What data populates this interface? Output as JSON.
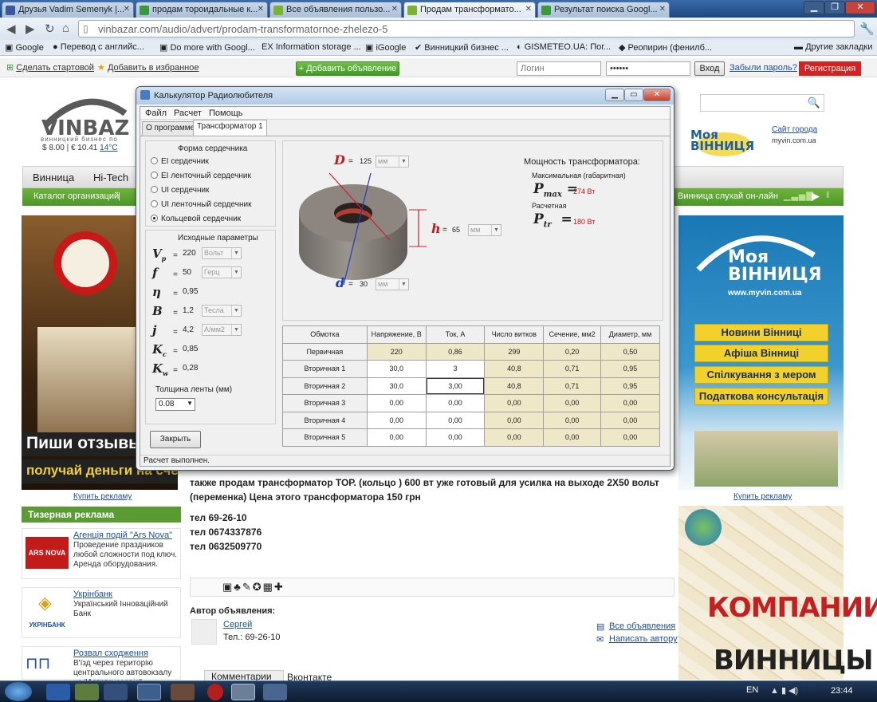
{
  "browser": {
    "tabs": [
      {
        "title": "Друзья Vadim Semenyk |...",
        "color": "#3b5998"
      },
      {
        "title": "продам тороидальные к...",
        "color": "#3a9a3a"
      },
      {
        "title": "Все объявления пользо...",
        "color": "#7ab32f"
      },
      {
        "title": "Продам трансформато...",
        "color": "#7ab32f"
      },
      {
        "title": "Результат поиска Googl...",
        "color": "#3a9a3a"
      }
    ],
    "url": "vinbazar.com/audio/advert/prodam-transformatornoe-zhelezo-5",
    "bookmarks": [
      "Google",
      "Перевод с английс...",
      "Do more with Googl...",
      "Information storage ...",
      "iGoogle",
      "Винницкий бизнес ...",
      "GISMETEO.UA: Пог...",
      "Реопирин (фенилб...",
      "Другие закладки"
    ]
  },
  "site": {
    "make_home": "Сделать стартовой",
    "add_favorites": "Добавить в избранное",
    "add_ad": "+ Добавить объявление",
    "login_placeholder": "Логин",
    "password_mask": "••••••",
    "login_button": "Вход",
    "forgot": "Забыли пароль?",
    "register": "Регистрация",
    "logo": "VINBAZ",
    "logo_sub": "винницкий бизнес по",
    "currency": [
      "$ 8.00",
      "€ 10.41",
      "14°C"
    ],
    "nav": [
      "Винница",
      "Hi-Tech"
    ],
    "subnav": [
      "Каталог организаций",
      "|"
    ],
    "radio": "Винница слухай он-лайн",
    "myvin_site": "Сайт города",
    "myvin_url": "myvin.com.ua",
    "myvin_logo": "Моя ВІННИЦЯ",
    "left_banner": [
      "Пиши отзывы -",
      "получай деньги на счет"
    ],
    "right_banner_title": "Моя ВІННИЦЯ",
    "right_banner_url": "www.myvin.com.ua",
    "right_buttons": [
      "Новини Вінниці",
      "Афіша Вінниці",
      "Спілкування з мером",
      "Податкова консультація"
    ],
    "buy_ad": "Купить рекламу",
    "teaser_header": "Тизерная реклама",
    "teasers": [
      {
        "title": "Агенція подій \"Ars Nova\"",
        "text": "Проведение праздников любой сложности под ключ. Аренда оборудования.",
        "logo": "ARS NOVA"
      },
      {
        "title": "Укрінбанк",
        "text": "Український Інноваційний Банк",
        "logo": "УКРІНБАНК"
      },
      {
        "title": "Розвал сходження",
        "text": "В'їзд через територію центрального автовокзалу на \"Автотехсервіс\"",
        "logo": ""
      }
    ],
    "ad_text": "также продам трансформатор ТОР. (кольцо ) 600 вт уже готовый для усилка на выходе 2Х50 вольт (переменка) Цена этого трансформатора 150 грн",
    "phones": [
      "тел 69-26-10",
      "тел 0674337876",
      "тел 0632509770"
    ],
    "author_label": "Автор объявления:",
    "author_name": "Сергей",
    "author_phone": "Тел.: 69-26-10",
    "all_ads": "Все объявления",
    "write_author": "Написать автору",
    "tab_comments": "Комментарии",
    "tab_vk": "Вконтакте",
    "companies": [
      "КОМПАНИИ",
      "ВИННИЦЫ"
    ]
  },
  "dialog": {
    "title": "Калькулятор Радиолюбителя",
    "menu": [
      "Файл",
      "Расчет",
      "Помощь"
    ],
    "tabs": [
      "О программе",
      "Трансформатор 1"
    ],
    "core_group": "Форма сердечника",
    "core_options": [
      {
        "label": "EI сердечник",
        "checked": false
      },
      {
        "label": "EI ленточный сердечник",
        "checked": false
      },
      {
        "label": "UI сердечник",
        "checked": false
      },
      {
        "label": "UI ленточный сердечник",
        "checked": false
      },
      {
        "label": "Кольцевой сердечник",
        "checked": true
      }
    ],
    "params_group": "Исходные параметры",
    "params": [
      {
        "sym": "V",
        "sub": "p",
        "value": "220",
        "unit": "Вольт"
      },
      {
        "sym": "f",
        "sub": "",
        "value": "50",
        "unit": "Герц"
      },
      {
        "sym": "η",
        "sub": "",
        "value": "0,95",
        "unit": ""
      },
      {
        "sym": "B",
        "sub": "",
        "value": "1,2",
        "unit": "Тесла"
      },
      {
        "sym": "j",
        "sub": "",
        "value": "4,2",
        "unit": "А/мм2"
      },
      {
        "sym": "K",
        "sub": "c",
        "value": "0,85",
        "unit": ""
      },
      {
        "sym": "K",
        "sub": "w",
        "value": "0,28",
        "unit": ""
      }
    ],
    "tape_label": "Толщина ленты (мм)",
    "tape_value": "0.08",
    "close_button": "Закрыть",
    "status": "Расчет выполнен.",
    "dims": [
      {
        "sym": "D",
        "value": "125",
        "unit": "мм"
      },
      {
        "sym": "h",
        "value": "65",
        "unit": "мм"
      },
      {
        "sym": "d",
        "value": "30",
        "unit": "мм"
      }
    ],
    "power_title": "Мощность трансформатора:",
    "pmax_label": "Максимальная (габаритная)",
    "pmax_sym": "P",
    "pmax_sub": "max",
    "pmax_value": "274 Вт",
    "ptr_label": "Расчетная",
    "ptr_sym": "P",
    "ptr_sub": "tr",
    "ptr_value": "180 Вт",
    "table_headers": [
      "Обмотка",
      "Напряжение, В",
      "Ток, А",
      "Число витков",
      "Сечение, мм2",
      "Диаметр, мм"
    ],
    "table_rows": [
      [
        "Первичная",
        "220",
        "0,86",
        "299",
        "0,20",
        "0,50"
      ],
      [
        "Вторичная 1",
        "30,0",
        "3",
        "40,8",
        "0,71",
        "0,95"
      ],
      [
        "Вторичная 2",
        "30,0",
        "3,00",
        "40,8",
        "0,71",
        "0,95"
      ],
      [
        "Вторичная 3",
        "0,00",
        "0,00",
        "0,00",
        "0,00",
        "0,00"
      ],
      [
        "Вторичная 4",
        "0,00",
        "0,00",
        "0,00",
        "0,00",
        "0,00"
      ],
      [
        "Вторичная 5",
        "0,00",
        "0,00",
        "0,00",
        "0,00",
        "0,00"
      ]
    ]
  },
  "taskbar": {
    "lang": "EN",
    "clock": "23:44"
  }
}
